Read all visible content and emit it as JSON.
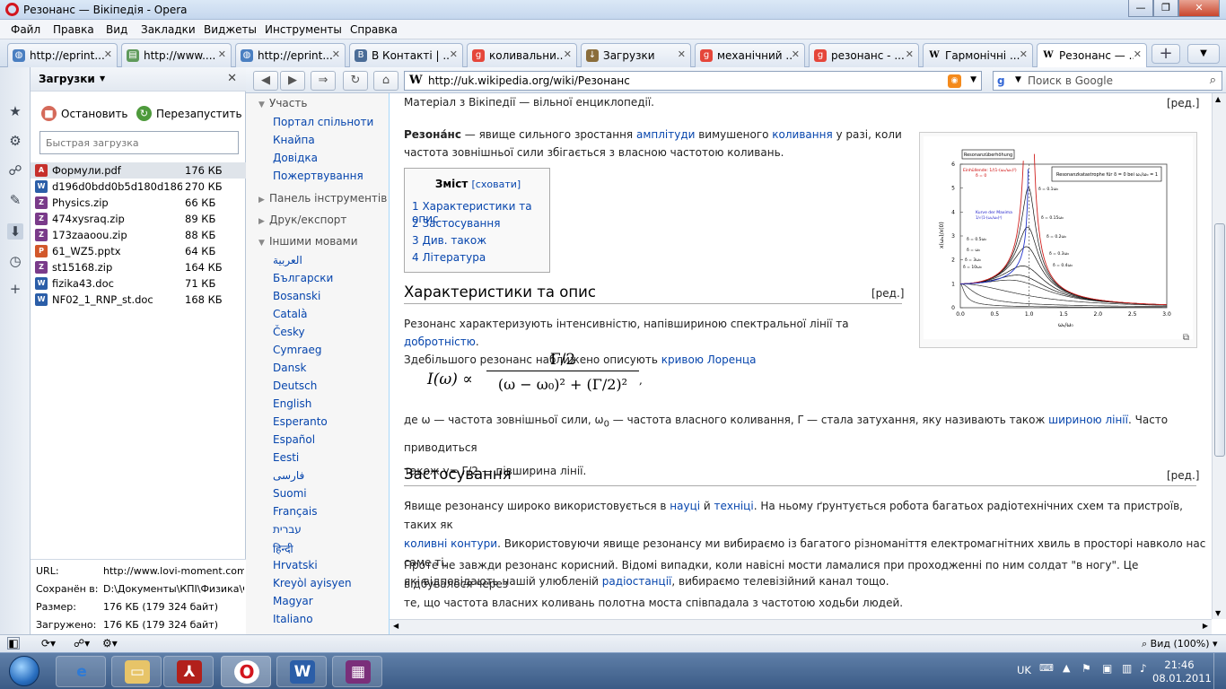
{
  "window": {
    "title": "Резонанс — Вікіпедія - Opera",
    "min": "—",
    "max": "❐",
    "close": "✕"
  },
  "menu": [
    "Файл",
    "Правка",
    "Вид",
    "Закладки",
    "Виджеты",
    "Инструменты",
    "Справка"
  ],
  "tabs": [
    {
      "label": "http://eprint...",
      "icon": "globe",
      "active": false
    },
    {
      "label": "http://www....",
      "icon": "doc",
      "active": false
    },
    {
      "label": "http://eprint...",
      "icon": "globe",
      "active": false
    },
    {
      "label": "В Контакті | ...",
      "icon": "vk",
      "active": false
    },
    {
      "label": "коливальни...",
      "icon": "google",
      "active": false
    },
    {
      "label": "Загрузки",
      "icon": "download",
      "active": false
    },
    {
      "label": "механічний ...",
      "icon": "google",
      "active": false
    },
    {
      "label": "резонанс - ...",
      "icon": "google",
      "active": false
    },
    {
      "label": "Гармонічні ...",
      "icon": "wiki",
      "active": false
    },
    {
      "label": "Резонанс — ...",
      "icon": "wiki",
      "active": true
    }
  ],
  "downloads_panel": {
    "title": "Загрузки",
    "stop_label": "Остановить",
    "restart_label": "Перезапустить",
    "search_placeholder": "Быстрая загрузка",
    "items": [
      {
        "name": "Формули.pdf",
        "size": "176 КБ",
        "type": "pdf",
        "selected": true
      },
      {
        "name": "d196d0bdd0b5d180d186d...",
        "size": "270 КБ",
        "type": "doc",
        "selected": false
      },
      {
        "name": "Physics.zip",
        "size": "66 КБ",
        "type": "zip",
        "selected": false
      },
      {
        "name": "474xysraq.zip",
        "size": "89 КБ",
        "type": "zip",
        "selected": false
      },
      {
        "name": "173zaaoou.zip",
        "size": "88 КБ",
        "type": "zip",
        "selected": false
      },
      {
        "name": "61_WZ5.pptx",
        "size": "64 КБ",
        "type": "ppt",
        "selected": false
      },
      {
        "name": "st15168.zip",
        "size": "164 КБ",
        "type": "zip",
        "selected": false
      },
      {
        "name": "fizika43.doc",
        "size": "71 КБ",
        "type": "doc",
        "selected": false
      },
      {
        "name": "NF02_1_RNP_st.doc",
        "size": "168 КБ",
        "type": "doc",
        "selected": false
      }
    ],
    "info": [
      {
        "key": "URL:",
        "value": "http://www.lovi-moment.com"
      },
      {
        "key": "Сохранён в:",
        "value": "D:\\Документы\\КПІ\\Физика\\Ф"
      },
      {
        "key": "Размер:",
        "value": "176 КБ (179 324 байт)"
      },
      {
        "key": "Загружено:",
        "value": "176 КБ (179 324 байт)"
      }
    ]
  },
  "navbar": {
    "url": "http://uk.wikipedia.org/wiki/Резонанс",
    "search_placeholder": "Поиск в Google"
  },
  "wiki_sidebar": {
    "sections": [
      {
        "title": "Участь",
        "links": [
          "Портал спільноти",
          "Кнайпа",
          "Довідка",
          "Пожертвування"
        ]
      },
      {
        "title": "Панель інструментів",
        "links": []
      },
      {
        "title": "Друк/експорт",
        "links": []
      },
      {
        "title": "Іншими мовами",
        "links": [
          "العربية",
          "Български",
          "Bosanski",
          "Català",
          "Česky",
          "Cymraeg",
          "Dansk",
          "Deutsch",
          "English",
          "Esperanto",
          "Español",
          "Eesti",
          "فارسی",
          "Suomi",
          "Français",
          "עברית",
          "हिन्दी",
          "Hrvatski",
          "Kreyòl ayisyen",
          "Magyar",
          "Italiano"
        ]
      }
    ]
  },
  "article": {
    "tagline": "Матеріал з Вікіпедії — вільної енциклопедії.",
    "edit": "[ред.]",
    "intro": {
      "term": "Резона́нс",
      "p1": " — явище сильного зростання ",
      "link1": "амплітуди",
      "p2": " вимушеного ",
      "link2": "коливання",
      "p3": " у разі, коли",
      "line2": "частота зовнішньої сили збігається з власною частотою коливань."
    },
    "toc": {
      "title": "Зміст",
      "toggle": "[сховати]",
      "items": [
        "1 Характеристики та опис",
        "2 Застосування",
        "3 Див. також",
        "4 Література"
      ]
    },
    "section1": {
      "heading": "Характеристики та опис",
      "l1a": "Резонанс характеризують інтенсивністю, напівшириною спектральної лінії та ",
      "l1link": "добротністю",
      "l1b": ".",
      "l2a": "Здебільшого резонанс наближено описують ",
      "l2link": "кривою Лоренца",
      "formula_lhs": "I(ω) ∝",
      "formula_num": "Γ/2",
      "formula_den": "(ω − ω₀)² + (Γ/2)²",
      "formula_end": ",",
      "w1": "де ω — частота зовнішньої сили, ω",
      "w1sub": "0",
      "w2": " — частота власного коливання, Γ — стала затухання, яку називають також ",
      "wlink": "шириною лінії",
      "w3": ". Часто приводиться",
      "w4": "також γ= Γ/2 — півширина лінії."
    },
    "section2": {
      "heading": "Застосування",
      "a1": "Явище резонансу широко використовується в ",
      "alink1": "науці",
      "a2": " й ",
      "alink2": "техніці",
      "a3": ". На ньому ґрунтується робота багатьох радіотехнічних схем та пристроїв, таких як",
      "blink": "коливні контури",
      "b1": ". Використовуючи явище резонансу ми вибираємо із багатого різноманіття електромагнітних хвиль в просторі навколо нас саме ті,",
      "c1": "які відповідають нашій улюбленій ",
      "clink": "радіостанції",
      "c2": ", вибираємо телевізійний канал тощо.",
      "d1": "Проте не завжди резонанс корисний. Відомі випадки, коли навісні мости ламалися при проходженні по ним солдат \"в ногу\". Це відбувалося через",
      "d2": "те, що частота власних коливань полотна моста співпадала з частотою ходьби людей."
    }
  },
  "figure": {
    "box_title": "Resonanzüberhöhung",
    "legend": "Resonanzkatastrophe für δ = 0 bei ωₐ/ω₀ = 1",
    "ylabel": "x(ωₐ)/x(0)",
    "xlabel": "ωₐ/ω₀",
    "env_label": "Einhüllende: 1/(1-(ωₐ/ω₀)²)",
    "env_delta": "δ = 0",
    "maxima_label": "Kurve der Maxima",
    "maxima_formula": "1/√(1-(ωₐ/ω₀)²)",
    "curve_labels": [
      "δ = 0.1ω₀",
      "δ = 0.15ω₀",
      "δ = 0.2ω₀",
      "δ = 0.3ω₀",
      "δ = 0.4ω₀"
    ],
    "left_labels": [
      "δ = 0.5ω₀",
      "δ = ω₀",
      "δ = 3ω₀",
      "δ = 10ω₀"
    ],
    "yticks": [
      "0",
      "1",
      "2",
      "3",
      "4",
      "5",
      "6"
    ],
    "xticks": [
      "0.0",
      "0.5",
      "1.0",
      "1.5",
      "2.0",
      "2.5",
      "3.0"
    ]
  },
  "status": {
    "zoom": "Вид (100%)"
  },
  "tray": {
    "lang": "UK",
    "time": "21:46",
    "date": "08.01.2011"
  }
}
